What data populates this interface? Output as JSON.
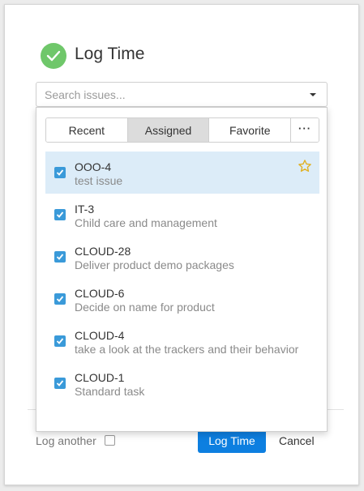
{
  "dialog": {
    "title": "Log Time",
    "title_icon": "check-circle-icon",
    "accent_green": "#6fc76a"
  },
  "search": {
    "placeholder": "Search issues...",
    "value": ""
  },
  "tabs": [
    {
      "label": "Recent",
      "active": false
    },
    {
      "label": "Assigned",
      "active": true
    },
    {
      "label": "Favorite",
      "active": false
    },
    {
      "label": "···",
      "active": false
    }
  ],
  "issues": [
    {
      "key": "OOO-4",
      "summary": "test issue",
      "checked": true,
      "selected": true,
      "star": true
    },
    {
      "key": "IT-3",
      "summary": "Child care and management",
      "checked": true,
      "selected": false,
      "star": false
    },
    {
      "key": "CLOUD-28",
      "summary": "Deliver product demo packages",
      "checked": true,
      "selected": false,
      "star": false
    },
    {
      "key": "CLOUD-6",
      "summary": "Decide on name for product",
      "checked": true,
      "selected": false,
      "star": false
    },
    {
      "key": "CLOUD-4",
      "summary": "take a look at the trackers and their behavior",
      "checked": true,
      "selected": false,
      "star": false
    },
    {
      "key": "CLOUD-1",
      "summary": "Standard task",
      "checked": true,
      "selected": false,
      "star": false
    }
  ],
  "footer": {
    "log_another_label": "Log another",
    "log_another_checked": false,
    "submit_label": "Log Time",
    "cancel_label": "Cancel",
    "submit_color": "#0d7fe0"
  }
}
